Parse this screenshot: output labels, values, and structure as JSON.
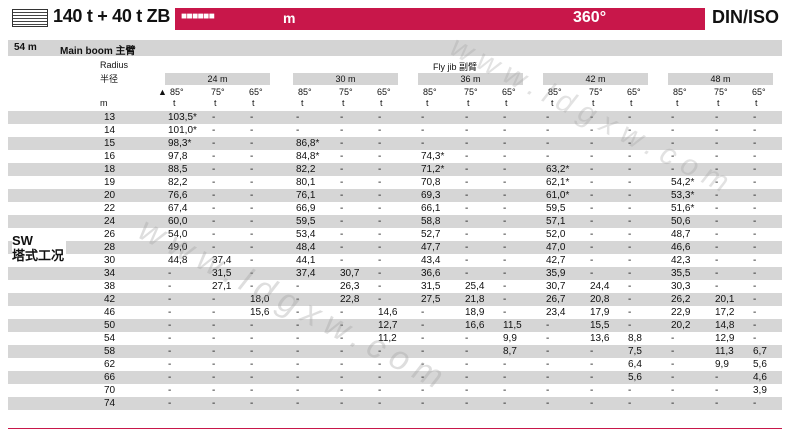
{
  "header": {
    "model": "140 t + 40 t ZB",
    "code": "■■■■■■",
    "unit": "m",
    "angle": "360°",
    "standard": "DIN/ISO"
  },
  "boom": {
    "length": "54 m",
    "label": "Main boom 主臂"
  },
  "columns": {
    "radius_label": "Radius",
    "radius_label_cn": "半径",
    "radius_unit": "m",
    "flyjib_label": "Fly jib 副臂",
    "marker": "▲",
    "unit": "t",
    "jibs": [
      "24 m",
      "30 m",
      "36 m",
      "42 m",
      "48 m"
    ],
    "angles": [
      "85°",
      "75°",
      "65°"
    ]
  },
  "side_label": {
    "line1": "SW",
    "line2": "塔式工况"
  },
  "watermark": "www.ldgxw.com",
  "rows": [
    {
      "r": "13",
      "v": [
        "103,5*",
        "-",
        "-",
        "-",
        "-",
        "-",
        "-",
        "-",
        "-",
        "-",
        "-",
        "-",
        "-",
        "-",
        "-"
      ]
    },
    {
      "r": "14",
      "v": [
        "101,0*",
        "-",
        "-",
        "-",
        "-",
        "-",
        "-",
        "-",
        "-",
        "-",
        "-",
        "-",
        "-",
        "-",
        "-"
      ]
    },
    {
      "r": "15",
      "v": [
        "98,3*",
        "-",
        "-",
        "86,8*",
        "-",
        "-",
        "-",
        "-",
        "-",
        "-",
        "-",
        "-",
        "-",
        "-",
        "-"
      ]
    },
    {
      "r": "16",
      "v": [
        "97,8",
        "-",
        "-",
        "84,8*",
        "-",
        "-",
        "74,3*",
        "-",
        "-",
        "-",
        "-",
        "-",
        "-",
        "-",
        "-"
      ]
    },
    {
      "r": "18",
      "v": [
        "88,5",
        "-",
        "-",
        "82,2",
        "-",
        "-",
        "71,2*",
        "-",
        "-",
        "63,2*",
        "-",
        "-",
        "-",
        "-",
        "-"
      ]
    },
    {
      "r": "19",
      "v": [
        "82,2",
        "-",
        "-",
        "80,1",
        "-",
        "-",
        "70,8",
        "-",
        "-",
        "62,1*",
        "-",
        "-",
        "54,2*",
        "-",
        "-"
      ]
    },
    {
      "r": "20",
      "v": [
        "76,6",
        "-",
        "-",
        "76,1",
        "-",
        "-",
        "69,3",
        "-",
        "-",
        "61,0*",
        "-",
        "-",
        "53,3*",
        "-",
        "-"
      ]
    },
    {
      "r": "22",
      "v": [
        "67,4",
        "-",
        "-",
        "66,9",
        "-",
        "-",
        "66,1",
        "-",
        "-",
        "59,5",
        "-",
        "-",
        "51,6*",
        "-",
        "-"
      ]
    },
    {
      "r": "24",
      "v": [
        "60,0",
        "-",
        "-",
        "59,5",
        "-",
        "-",
        "58,8",
        "-",
        "-",
        "57,1",
        "-",
        "-",
        "50,6",
        "-",
        "-"
      ]
    },
    {
      "r": "26",
      "v": [
        "54,0",
        "-",
        "-",
        "53,4",
        "-",
        "-",
        "52,7",
        "-",
        "-",
        "52,0",
        "-",
        "-",
        "48,7",
        "-",
        "-"
      ]
    },
    {
      "r": "28",
      "v": [
        "49,0",
        "-",
        "-",
        "48,4",
        "-",
        "-",
        "47,7",
        "-",
        "-",
        "47,0",
        "-",
        "-",
        "46,6",
        "-",
        "-"
      ]
    },
    {
      "r": "30",
      "v": [
        "44,8",
        "37,4",
        "-",
        "44,1",
        "-",
        "-",
        "43,4",
        "-",
        "-",
        "42,7",
        "-",
        "-",
        "42,3",
        "-",
        "-"
      ]
    },
    {
      "r": "34",
      "v": [
        "-",
        "31,5",
        "-",
        "37,4",
        "30,7",
        "-",
        "36,6",
        "-",
        "-",
        "35,9",
        "-",
        "-",
        "35,5",
        "-",
        "-"
      ]
    },
    {
      "r": "38",
      "v": [
        "-",
        "27,1",
        "-",
        "-",
        "26,3",
        "-",
        "31,5",
        "25,4",
        "-",
        "30,7",
        "24,4",
        "-",
        "30,3",
        "-",
        "-"
      ]
    },
    {
      "r": "42",
      "v": [
        "-",
        "-",
        "18,0",
        "-",
        "22,8",
        "-",
        "27,5",
        "21,8",
        "-",
        "26,7",
        "20,8",
        "-",
        "26,2",
        "20,1",
        "-"
      ]
    },
    {
      "r": "46",
      "v": [
        "-",
        "-",
        "15,6",
        "-",
        "-",
        "14,6",
        "-",
        "18,9",
        "-",
        "23,4",
        "17,9",
        "-",
        "22,9",
        "17,2",
        "-"
      ]
    },
    {
      "r": "50",
      "v": [
        "-",
        "-",
        "-",
        "-",
        "-",
        "12,7",
        "-",
        "16,6",
        "11,5",
        "-",
        "15,5",
        "-",
        "20,2",
        "14,8",
        "-"
      ]
    },
    {
      "r": "54",
      "v": [
        "-",
        "-",
        "-",
        "-",
        "-",
        "11,2",
        "-",
        "-",
        "9,9",
        "-",
        "13,6",
        "8,8",
        "-",
        "12,9",
        "-"
      ]
    },
    {
      "r": "58",
      "v": [
        "-",
        "-",
        "-",
        "-",
        "-",
        "-",
        "-",
        "-",
        "8,7",
        "-",
        "-",
        "7,5",
        "-",
        "11,3",
        "6,7"
      ]
    },
    {
      "r": "62",
      "v": [
        "-",
        "-",
        "-",
        "-",
        "-",
        "-",
        "-",
        "-",
        "-",
        "-",
        "-",
        "6,4",
        "-",
        "9,9",
        "5,6"
      ]
    },
    {
      "r": "66",
      "v": [
        "-",
        "-",
        "-",
        "-",
        "-",
        "-",
        "-",
        "-",
        "-",
        "-",
        "-",
        "5,6",
        "-",
        "-",
        "4,6"
      ]
    },
    {
      "r": "70",
      "v": [
        "-",
        "-",
        "-",
        "-",
        "-",
        "-",
        "-",
        "-",
        "-",
        "-",
        "-",
        "-",
        "-",
        "-",
        "3,9"
      ]
    },
    {
      "r": "74",
      "v": [
        "-",
        "-",
        "-",
        "-",
        "-",
        "-",
        "-",
        "-",
        "-",
        "-",
        "-",
        "-",
        "-",
        "-",
        "-"
      ]
    }
  ]
}
